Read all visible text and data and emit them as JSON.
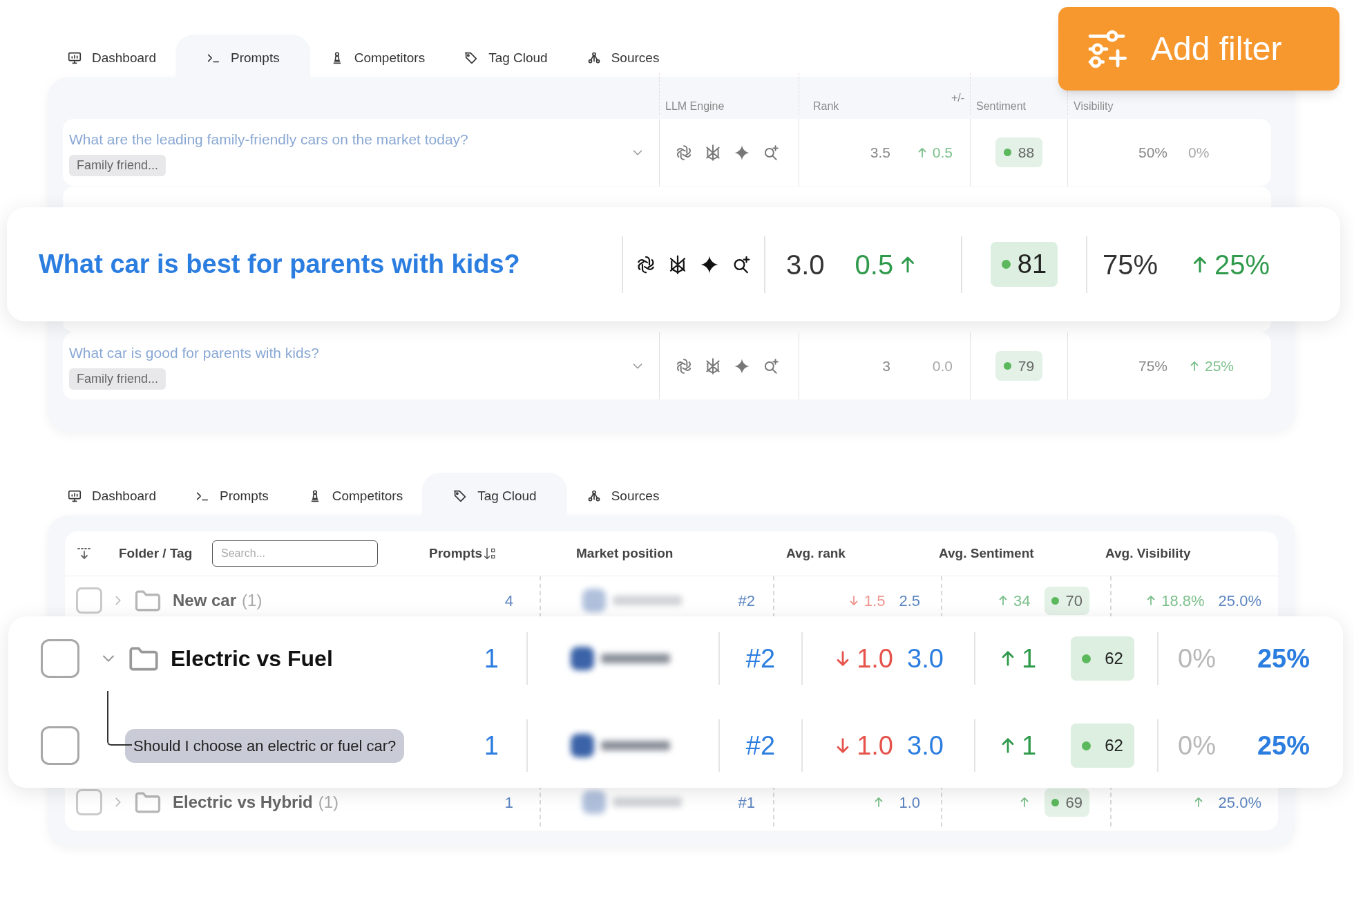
{
  "add_filter_button": {
    "label": "Add filter"
  },
  "prompts_panel": {
    "tabs": [
      {
        "label": "Dashboard",
        "selected": false
      },
      {
        "label": "Prompts",
        "selected": true
      },
      {
        "label": "Competitors",
        "selected": false
      },
      {
        "label": "Tag Cloud",
        "selected": false
      },
      {
        "label": "Sources",
        "selected": false
      }
    ],
    "columns": [
      "LLM Engine",
      "Rank",
      "+/-",
      "Sentiment",
      "Visibility"
    ],
    "rows": [
      {
        "prompt": "What are the leading family-friendly cars on the market today?",
        "tag": "Family friend...",
        "rank": "3.5",
        "rank_change": {
          "kind": "up",
          "value": "0.5"
        },
        "sentiment": "88",
        "visibility": "50%",
        "visibility_change": {
          "kind": "flat",
          "value": "0%"
        }
      },
      {
        "prompt": "What car is good for parents with kids?",
        "tag": "Family friend...",
        "rank": "3",
        "rank_change": {
          "kind": "flat",
          "value": "0.0"
        },
        "sentiment": "79",
        "visibility": "75%",
        "visibility_change": {
          "kind": "up",
          "value": "25%"
        }
      }
    ],
    "highlighted_row": {
      "prompt": "What car is best for parents with kids?",
      "rank": "3.0",
      "rank_change": {
        "kind": "up",
        "value": "0.5"
      },
      "sentiment": "81",
      "visibility": "75%",
      "visibility_change": {
        "kind": "up",
        "value": "25%"
      }
    }
  },
  "tag_cloud_panel": {
    "tabs": [
      {
        "label": "Dashboard",
        "selected": false
      },
      {
        "label": "Prompts",
        "selected": false
      },
      {
        "label": "Competitors",
        "selected": false
      },
      {
        "label": "Tag Cloud",
        "selected": true
      },
      {
        "label": "Sources",
        "selected": false
      }
    ],
    "search": {
      "placeholder": "Search..."
    },
    "columns": [
      "Folder / Tag",
      "Prompts",
      "Market position",
      "Avg. rank",
      "Avg. Sentiment",
      "Avg. Visibility"
    ],
    "rows": [
      {
        "name": "New car",
        "count": "(1)",
        "checked": false,
        "expanded": false,
        "prompts": "4",
        "position": "#2",
        "rank_change": {
          "kind": "down",
          "value": "1.5"
        },
        "avg_rank": "2.5",
        "sentiment_change": {
          "kind": "up",
          "value": "34"
        },
        "sentiment": "70",
        "visibility_change": {
          "kind": "up",
          "value": "18.8%"
        },
        "visibility": "25.0%"
      },
      {
        "name": "Electric vs Hybrid",
        "count": "(1)",
        "checked": false,
        "expanded": false,
        "prompts": "1",
        "position": "#1",
        "rank_change": {
          "kind": "up"
        },
        "avg_rank": "1.0",
        "sentiment_change": {
          "kind": "up"
        },
        "sentiment": "69",
        "visibility_change": {
          "kind": "up"
        },
        "visibility": "25.0%"
      }
    ],
    "highlighted_rows": [
      {
        "kind": "folder",
        "name": "Electric vs Fuel",
        "checked": false,
        "expanded": true,
        "prompts": "1",
        "position": "#2",
        "rank_change": {
          "kind": "down",
          "value": "1.0"
        },
        "avg_rank": "3.0",
        "sentiment_change": {
          "kind": "up",
          "value": "1"
        },
        "sentiment": "62",
        "visibility_change": {
          "kind": "flat",
          "value": "0%"
        },
        "visibility": "25%"
      },
      {
        "kind": "prompt",
        "name": "Should I choose an electric or fuel car?",
        "checked": false,
        "prompts": "1",
        "position": "#2",
        "rank_change": {
          "kind": "down",
          "value": "1.0"
        },
        "avg_rank": "3.0",
        "sentiment_change": {
          "kind": "up",
          "value": "1"
        },
        "sentiment": "62",
        "visibility_change": {
          "kind": "flat",
          "value": "0%"
        },
        "visibility": "25%"
      }
    ]
  }
}
